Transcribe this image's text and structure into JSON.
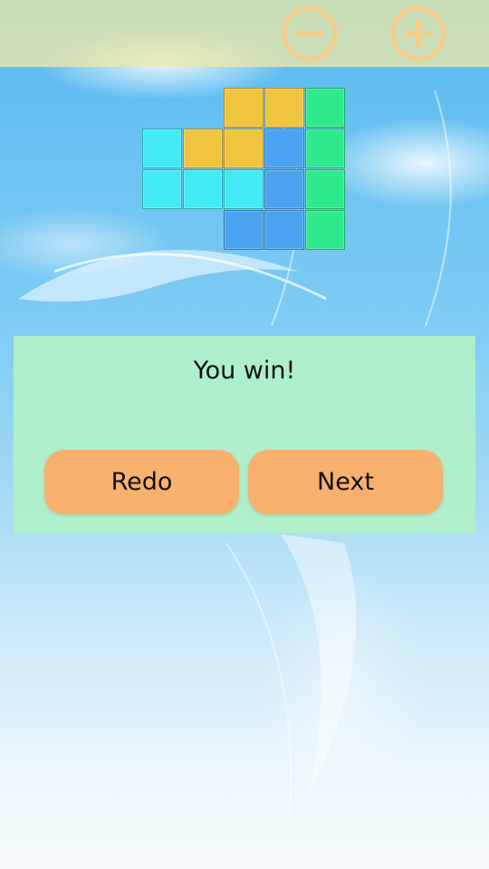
{
  "dialog": {
    "message": "You win!",
    "redo_label": "Redo",
    "next_label": "Next"
  },
  "toolbar": {
    "zoom_out_icon": "minus-circle-icon",
    "zoom_in_icon": "plus-circle-icon",
    "icon_color": "#f5cf8a"
  },
  "colors": {
    "yellow": "#efc43e",
    "green": "#2eea8c",
    "cyan": "#42eaf3",
    "blue": "#4aa3f1",
    "dialog_bg": "#b0f0c8",
    "button_bg": "#f7b06e"
  },
  "board": {
    "rows": [
      [
        null,
        null,
        null,
        null,
        null,
        null,
        null,
        null,
        null,
        null,
        null,
        null
      ],
      [
        null,
        null,
        null,
        "yellow",
        "yellow",
        "green"
      ],
      [
        null,
        "cyan",
        "yellow",
        "yellow",
        "blue",
        "green"
      ],
      [
        null,
        "cyan",
        "cyan",
        "cyan",
        "blue",
        "green"
      ],
      [
        null,
        null,
        null,
        "blue",
        "blue",
        "green"
      ]
    ]
  }
}
